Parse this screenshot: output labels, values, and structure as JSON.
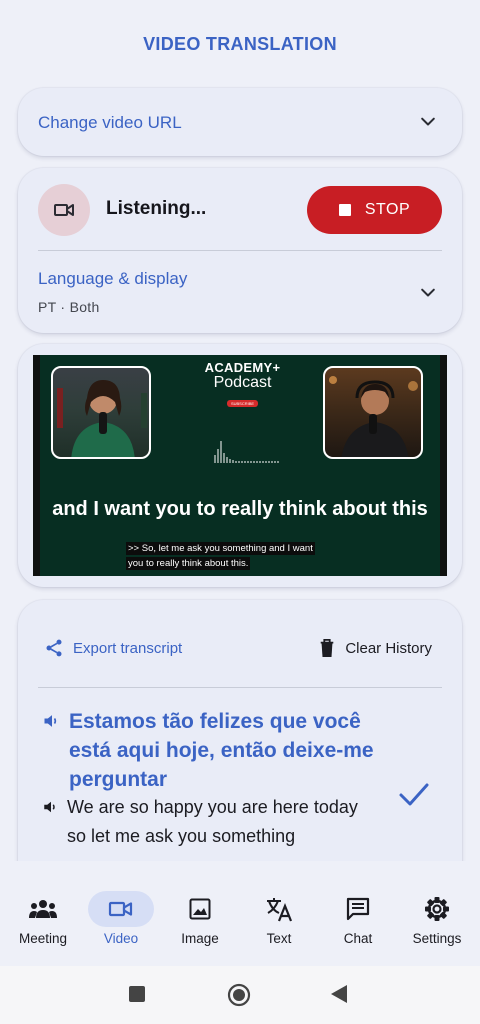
{
  "app": {
    "title": "VIDEO TRANSLATION"
  },
  "url_panel": {
    "label": "Change video URL"
  },
  "listening": {
    "status": "Listening...",
    "stop_label": "STOP",
    "language_title": "Language & display",
    "language_value": "PT · Both"
  },
  "video": {
    "logo_line1": "ACADEMY+",
    "logo_side": "ENGLISH",
    "logo_line2": "Podcast",
    "logo_badge": "SUBSCRIBE",
    "caption_main": "and I want you to really think about this",
    "caption_sub_line1": ">> So, let me ask you something and I want",
    "caption_sub_line2": "you to really think about this."
  },
  "transcript": {
    "export_label": "Export transcript",
    "clear_label": "Clear History",
    "translated": "Estamos tão felizes que você está aqui hoje, então deixe-me perguntar",
    "original": "We are so happy you are here today so let me ask you something"
  },
  "nav": {
    "items": [
      {
        "label": "Meeting",
        "icon": "meeting-icon"
      },
      {
        "label": "Video",
        "icon": "video-icon",
        "active": true
      },
      {
        "label": "Image",
        "icon": "image-icon"
      },
      {
        "label": "Text",
        "icon": "translate-icon"
      },
      {
        "label": "Chat",
        "icon": "chat-icon"
      },
      {
        "label": "Settings",
        "icon": "gear-icon"
      }
    ]
  },
  "colors": {
    "accent": "#3b63c4",
    "stop": "#c81e24",
    "card": "#e9ecf7",
    "background": "#eef0f8"
  }
}
